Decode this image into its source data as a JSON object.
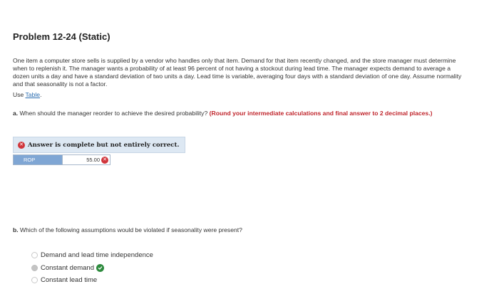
{
  "problem": {
    "title": "Problem 12-24 (Static)",
    "text": "One item a computer store sells is supplied by a vendor who handles only that item. Demand for that item recently changed, and the store manager must determine when to replenish it. The manager wants a probability of at least 96 percent of not having a stockout during lead time. The manager expects demand to average a dozen units a day and have a standard deviation of two units a day. Lead time is variable, averaging four days with a standard deviation of one day. Assume normality and that seasonality is not a factor.",
    "use_prefix": "Use ",
    "use_link": "Table",
    "use_suffix": "."
  },
  "question_a": {
    "prefix": "a.",
    "text": " When should the manager reorder to achieve the desired probability? ",
    "instruction": "(Round your intermediate calculations and final answer to 2 decimal places.)",
    "status": "Answer is complete but not entirely correct.",
    "rop_label": "ROP",
    "rop_value": "55.00"
  },
  "question_b": {
    "prefix": "b.",
    "text": " Which of the following assumptions would be violated if seasonality were present?",
    "options": [
      {
        "label": "Demand and lead time independence",
        "selected": false
      },
      {
        "label": "Constant demand",
        "selected": true
      },
      {
        "label": "Constant lead time",
        "selected": false
      }
    ]
  },
  "icons": {
    "incorrect": "x-circle-icon",
    "correct": "check-circle-icon"
  },
  "colors": {
    "instruction_red": "#c0262d",
    "link_blue": "#2a6db0",
    "rop_header": "#7fa6d4",
    "answer_box_bg": "#dde8f3",
    "correct_green": "#2e8b3e",
    "incorrect_red": "#d0353b"
  }
}
